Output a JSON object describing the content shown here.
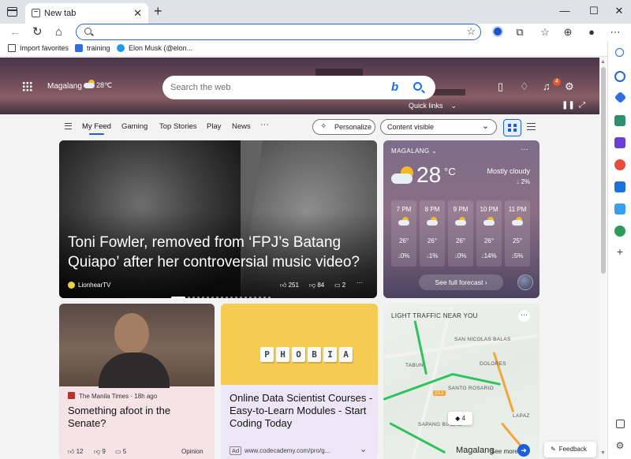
{
  "browser": {
    "tab_title": "New tab",
    "tab_close": "✕",
    "new_tab": "+",
    "window_controls": {
      "minimize": "—",
      "maximize": "☐",
      "close": "✕"
    },
    "address_value": "",
    "favorites": [
      {
        "label": "Import favorites",
        "icon": "import-icon"
      },
      {
        "label": "training",
        "icon": "folder-icon"
      },
      {
        "label": "Elon Musk (@elon...",
        "icon": "twitter-icon"
      }
    ]
  },
  "hero": {
    "location": "Magalang",
    "temp": "28℃",
    "search_placeholder": "Search the web",
    "quick_links": "Quick links",
    "notification_count": "4"
  },
  "feed_nav": {
    "tabs": [
      "My Feed",
      "Gaming",
      "Top Stories",
      "Play",
      "News"
    ],
    "more": "···",
    "personalize": "Personalize",
    "content_visible": "Content visible"
  },
  "main_story": {
    "headline": "Toni Fowler, removed from ‘FPJ’s Batang Quiapo’ after her controversial music video?",
    "source": "LionhearTV",
    "likes": "251",
    "dislikes": "84",
    "comments": "2",
    "more": "···"
  },
  "weather": {
    "location": "MAGALANG",
    "temp": "28",
    "unit": "°C",
    "condition": "Mostly cloudy",
    "precip": "2%",
    "hourly": [
      {
        "time": "7 PM",
        "temp": "26°",
        "precip": "0%"
      },
      {
        "time": "8 PM",
        "temp": "26°",
        "precip": "1%"
      },
      {
        "time": "9 PM",
        "temp": "26°",
        "precip": "0%"
      },
      {
        "time": "10 PM",
        "temp": "26°",
        "precip": "14%"
      },
      {
        "time": "11 PM",
        "temp": "25°",
        "precip": "5%"
      }
    ],
    "see_forecast": "See full forecast ›",
    "more": "···"
  },
  "senate_card": {
    "source": "The Manila Times · 18h ago",
    "title": "Something afoot in the Senate?",
    "likes": "12",
    "dislikes": "9",
    "comments": "5",
    "label": "Opinion"
  },
  "ad_card": {
    "tiles": [
      "P",
      "H",
      "O",
      "B",
      "I",
      "A"
    ],
    "title": "Online Data Scientist Courses - Easy-to-Learn Modules - Start Coding Today",
    "badge": "Ad",
    "url": "www.codecademy.com/pro/g...",
    "chevron": "⌄"
  },
  "traffic_card": {
    "title": "LIGHT TRAFFIC NEAR YOU",
    "more": "···",
    "labels": [
      "SAN NICOLAS BALAS",
      "TABUN",
      "DOLORES",
      "SANTO ROSARIO",
      "LAPAZ",
      "SAPANG BIABAS",
      "212"
    ],
    "incidents": "4",
    "city": "Magalang",
    "see_more": "See more"
  },
  "feedback": "Feedback",
  "colors": {
    "accent": "#1b60d8",
    "traffic_green": "#31c25e",
    "traffic_orange": "#f2a53a"
  }
}
